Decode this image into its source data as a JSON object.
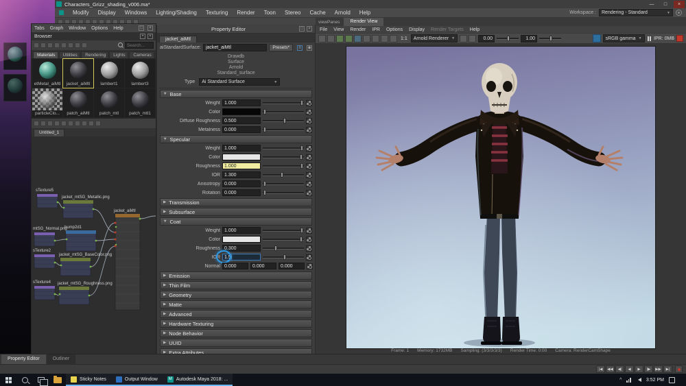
{
  "window": {
    "title": "Characters_Grizz_shading_v006.ma*",
    "menus": [
      "Modify",
      "Display",
      "Windows",
      "Lighting/Shading",
      "Texturing",
      "Render",
      "Toon",
      "Stereo",
      "Cache",
      "Arnold",
      "Help"
    ],
    "workspace_label": "Workspace :",
    "workspace_value": "Rendering - Standard",
    "controls": {
      "minimize": "—",
      "maximize": "□",
      "close": "×"
    }
  },
  "hypershade": {
    "menus": [
      "Tabs",
      "Graph",
      "Window",
      "Options",
      "Help"
    ],
    "browser_title": "Browser",
    "search_placeholder": "Search...",
    "category_tabs": [
      "Materials",
      "Utilities",
      "Rendering",
      "Lights",
      "Cameras"
    ],
    "swatches": [
      {
        "label": "etMetal_aiMtl",
        "kind": "metal",
        "selected": false
      },
      {
        "label": "jacket_aiMtl",
        "kind": "dark",
        "selected": true
      },
      {
        "label": "lambert1",
        "kind": "gray",
        "selected": false
      },
      {
        "label": "lambert3",
        "kind": "gray",
        "selected": false
      },
      {
        "label": "particleClo...",
        "kind": "checker",
        "selected": false
      },
      {
        "label": "patch_aiMtl",
        "kind": "dark",
        "selected": false
      },
      {
        "label": "patch_mtl",
        "kind": "dark",
        "selected": false
      },
      {
        "label": "patch_mtl1",
        "kind": "dark",
        "selected": false
      }
    ],
    "graph_tab": "Untitled_1",
    "nodes": [
      {
        "label": "sTexture5"
      },
      {
        "label": "jacket_mtSG_Metallic.png"
      },
      {
        "label": "mtSG_Normal.png"
      },
      {
        "label": "bump2d1"
      },
      {
        "label": "sTexture2"
      },
      {
        "label": "jacket_mtSG_BaseColor.png"
      },
      {
        "label": "sTexture4"
      },
      {
        "label": "jacket_mtSG_Roughness.png"
      },
      {
        "label": "jacket_aiMtl"
      }
    ]
  },
  "property_editor": {
    "header": "Property Editor",
    "tab": "jacket_aiMtl",
    "type_field_label": "aiStandardSurface:",
    "type_field_value": "jacket_aiMtl",
    "presets_button": "Presets*",
    "classification": [
      "Drawdb",
      "Surface",
      "Arnold",
      "Standard_surface"
    ],
    "type_label": "Type",
    "type_value": "Ai Standard Surface",
    "sections": [
      {
        "title": "Base",
        "expanded": true,
        "rows": [
          {
            "label": "Weight",
            "type": "slider",
            "value": "1.000",
            "pos": 92
          },
          {
            "label": "Color",
            "type": "color",
            "swatch": "#060606",
            "pos": 2
          },
          {
            "label": "Diffuse Roughness",
            "type": "slider",
            "value": "0.500",
            "pos": 50
          },
          {
            "label": "Metalness",
            "type": "slider",
            "value": "0.000",
            "pos": 2
          }
        ]
      },
      {
        "title": "Specular",
        "expanded": true,
        "rows": [
          {
            "label": "Weight",
            "type": "slider",
            "value": "1.000",
            "pos": 92
          },
          {
            "label": "Color",
            "type": "color",
            "swatch": "#e6e6e6",
            "pos": 90
          },
          {
            "label": "Roughness",
            "type": "slider",
            "value": "1.000",
            "pos": 92,
            "highlight": true
          },
          {
            "label": "IOR",
            "type": "slider",
            "value": "1.300",
            "pos": 43
          },
          {
            "label": "Anisotropy",
            "type": "slider",
            "value": "0.000",
            "pos": 2
          },
          {
            "label": "Rotation",
            "type": "slider",
            "value": "0.000",
            "pos": 2
          }
        ]
      },
      {
        "title": "Transmission",
        "expanded": false
      },
      {
        "title": "Subsurface",
        "expanded": false
      },
      {
        "title": "Coat",
        "expanded": true,
        "rows": [
          {
            "label": "Weight",
            "type": "slider",
            "value": "1.000",
            "pos": 92
          },
          {
            "label": "Color",
            "type": "color",
            "swatch": "#e6e6e6",
            "pos": 90
          },
          {
            "label": "Roughness",
            "type": "slider",
            "value": "0.300",
            "pos": 28
          },
          {
            "label": "IOR",
            "type": "slider",
            "value": "1.5",
            "pos": 50,
            "editing": true
          },
          {
            "label": "Normal",
            "type": "vector",
            "values": [
              "0.000",
              "0.000",
              "0.000"
            ]
          }
        ]
      },
      {
        "title": "Emission",
        "expanded": false
      },
      {
        "title": "Thin Film",
        "expanded": false
      },
      {
        "title": "Geometry",
        "expanded": false
      },
      {
        "title": "Matte",
        "expanded": false
      },
      {
        "title": "Advanced",
        "expanded": false
      },
      {
        "title": "Hardware Texturing",
        "expanded": false
      },
      {
        "title": "Node Behavior",
        "expanded": false
      },
      {
        "title": "UUID",
        "expanded": false
      },
      {
        "title": "Extra Attributes",
        "expanded": false
      }
    ]
  },
  "render_view": {
    "pane_label": "viewPanes",
    "tab": "Render View",
    "menus": [
      "File",
      "View",
      "Render",
      "IPR",
      "Options",
      "Display",
      "Render Targets",
      "Help"
    ],
    "disabled_menu": "Render Targets",
    "icons_left": [
      "open-image-icon",
      "save-image-icon",
      "redo-render-icon",
      "ipr-render-icon",
      "region-render-icon",
      "snapshot-icon",
      "keep-image-icon",
      "remove-image-icon",
      "render-settings-icon"
    ],
    "zoom_label": "1:1",
    "renderer_dropdown": "Arnold Renderer",
    "icons_mid": [
      "rgb-channels-icon",
      "alpha-channel-icon"
    ],
    "exposure": "0.00",
    "gamma": "1.00",
    "colorspace_dropdown": "sRGB gamma",
    "ipr_memory": "IPR: 0MB",
    "status_line": [
      "Frame: 1",
      "Memory: 1732MB",
      "Sampling: (3/3/3/3/3)",
      "Render Time: 0:00",
      "Camera: RenderCamShape"
    ]
  },
  "bottom": {
    "panel_tabs": [
      "Property Editor",
      "Outliner"
    ],
    "playback": [
      {
        "name": "go-to-start",
        "glyph": "|◀"
      },
      {
        "name": "step-back-frame",
        "glyph": "◀◀"
      },
      {
        "name": "step-back-key",
        "glyph": "◀|"
      },
      {
        "name": "play-backwards",
        "glyph": "◀"
      },
      {
        "name": "play-forwards",
        "glyph": "▶"
      },
      {
        "name": "step-forward-key",
        "glyph": "|▶"
      },
      {
        "name": "step-forward-frame",
        "glyph": "▶▶"
      },
      {
        "name": "go-to-end",
        "glyph": "▶|"
      }
    ]
  },
  "taskbar": {
    "apps": [
      {
        "label": "Sticky Notes",
        "icon": "sticky-notes"
      },
      {
        "label": "Output Window",
        "icon": "output-window"
      },
      {
        "label": "Autodesk Maya 2018: ...",
        "icon": "maya"
      }
    ],
    "time": "3:52 PM"
  },
  "colors": {
    "accent": "#5285a6",
    "highlight_yellow": "#f0eda0",
    "stop_red": "#c0392b"
  }
}
